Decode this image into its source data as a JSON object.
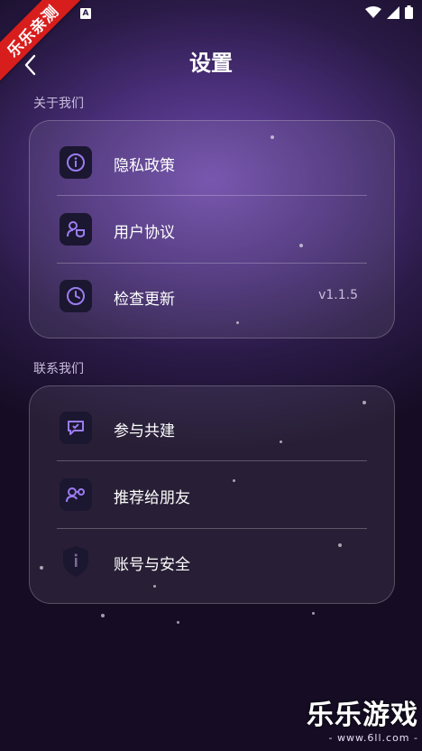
{
  "status_bar": {
    "badge": "A"
  },
  "ribbon": {
    "text": "乐乐亲测"
  },
  "header": {
    "title": "设置"
  },
  "sections": [
    {
      "label": "关于我们",
      "items": [
        {
          "label": "隐私政策",
          "icon": "info-icon"
        },
        {
          "label": "用户协议",
          "icon": "user-agreement-icon"
        },
        {
          "label": "检查更新",
          "icon": "clock-icon",
          "value": "v1.1.5"
        }
      ]
    },
    {
      "label": "联系我们",
      "items": [
        {
          "label": "参与共建",
          "icon": "feedback-chat-icon"
        },
        {
          "label": "推荐给朋友",
          "icon": "share-friends-icon"
        },
        {
          "label": "账号与安全",
          "icon": "shield-icon"
        }
      ]
    }
  ],
  "watermark": {
    "title": "乐乐游戏",
    "url": "- www.6ll.com -"
  },
  "colors": {
    "accent": "#9b7cf0",
    "icon_bg": "#1c1730",
    "ribbon": "#d81d1d"
  }
}
